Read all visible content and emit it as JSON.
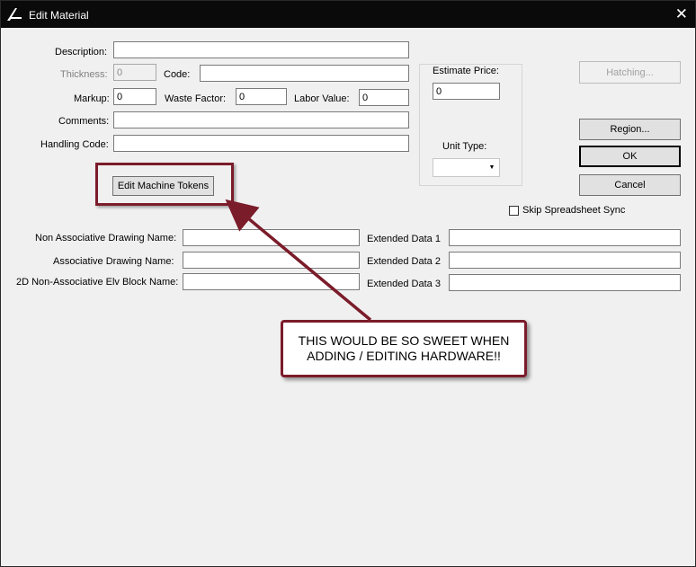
{
  "window": {
    "title": "Edit Material"
  },
  "icons": {
    "app": "app-logo-icon",
    "close": "close-icon",
    "dropdown": "chevron-down-icon"
  },
  "fields": {
    "description": {
      "label": "Description:",
      "value": ""
    },
    "thickness": {
      "label": "Thickness:",
      "value": "0"
    },
    "code": {
      "label": "Code:",
      "value": ""
    },
    "markup": {
      "label": "Markup:",
      "value": "0"
    },
    "waste_factor": {
      "label": "Waste Factor:",
      "value": "0"
    },
    "labor_value": {
      "label": "Labor Value:",
      "value": "0"
    },
    "comments": {
      "label": "Comments:",
      "value": ""
    },
    "handling_code": {
      "label": "Handling Code:",
      "value": ""
    }
  },
  "estimate": {
    "price_label": "Estimate Price:",
    "price_value": "0",
    "unit_type_label": "Unit Type:",
    "unit_type_value": ""
  },
  "buttons": {
    "edit_machine_tokens": "Edit Machine Tokens",
    "hatching": "Hatching...",
    "region": "Region...",
    "ok": "OK",
    "cancel": "Cancel"
  },
  "skip_sync": {
    "label": "Skip Spreadsheet Sync",
    "checked": false
  },
  "drawing_fields": {
    "non_assoc": {
      "label": "Non Associative Drawing Name:",
      "value": ""
    },
    "assoc": {
      "label": "Associative Drawing Name:",
      "value": ""
    },
    "block_2d": {
      "label": "2D Non-Associative Elv Block Name:",
      "value": ""
    }
  },
  "extended_data": {
    "ext1": {
      "label": "Extended Data 1",
      "value": ""
    },
    "ext2": {
      "label": "Extended Data 2",
      "value": ""
    },
    "ext3": {
      "label": "Extended Data 3",
      "value": ""
    }
  },
  "annotation": {
    "line1": "THIS WOULD BE SO SWEET WHEN",
    "line2": "ADDING / EDITING HARDWARE!!",
    "color": "#7b1c2a"
  }
}
